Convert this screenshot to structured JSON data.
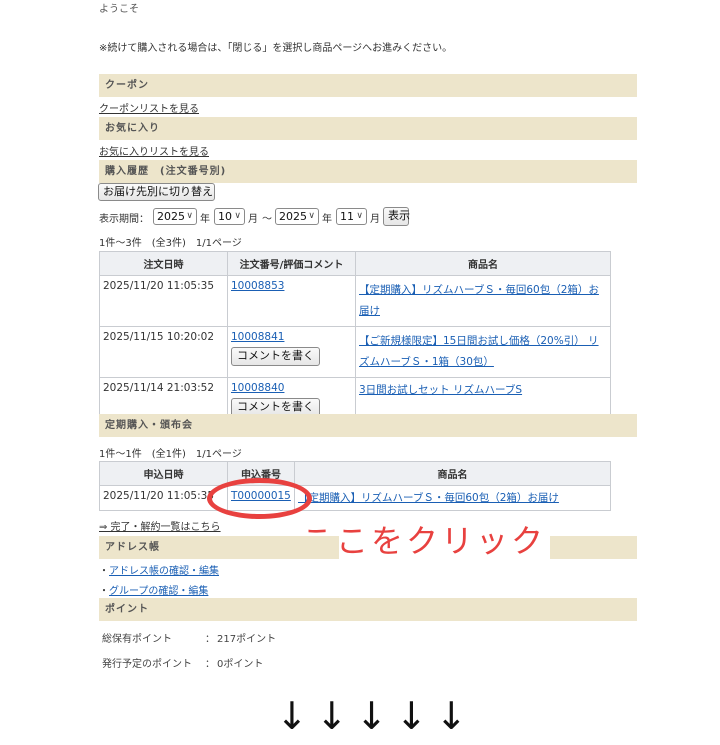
{
  "welcome": "ようこそ",
  "notice": "※続けて購入される場合は、「閉じる」を選択し商品ページへお進みください。",
  "coupon": {
    "title": "クーポン",
    "link": "クーポンリストを見る"
  },
  "favorites": {
    "title": "お気に入り",
    "link": "お気に入りリストを見る"
  },
  "history": {
    "title": "購入履歴　(注文番号別)",
    "switch_button": "お届け先別に切り替え",
    "period_label": "表示期間：",
    "from_year": "2025",
    "year_unit": "年",
    "from_month": "10",
    "month_unit": "月",
    "tilde": "〜",
    "to_year": "2025",
    "to_month": "11",
    "show_button": "表示",
    "count": "1件〜3件　(全3件)　1/1ページ",
    "columns": [
      "注文日時",
      "注文番号/評価コメント",
      "商品名"
    ],
    "comment_button": "コメントを書く",
    "rows": [
      {
        "date": "2025/11/20 11:05:35",
        "order": "10008853",
        "product": "【定期購入】リズムハーブＳ・毎回60包（2箱）お届け"
      },
      {
        "date": "2025/11/15 10:20:02",
        "order": "10008841",
        "product": "【ご新規様限定】15日間お試し価格（20%引） リズムハーブＳ・1箱（30包）"
      },
      {
        "date": "2025/11/14 21:03:52",
        "order": "10008840",
        "product": "3日間お試しセット リズムハーブS"
      }
    ]
  },
  "subscription": {
    "title": "定期購入・頒布会",
    "count": "1件〜1件　(全1件)　1/1ページ",
    "columns": [
      "申込日時",
      "申込番号",
      "商品名"
    ],
    "rows": [
      {
        "date": "2025/11/20 11:05:35",
        "number": "T00000015",
        "product": "【定期購入】リズムハーブＳ・毎回60包（2箱）お届け"
      }
    ],
    "completed_link": "⇒ 完了・解約一覧はこちら"
  },
  "annotation": {
    "click_here": "ここをクリック",
    "arrows": "↓↓↓↓↓",
    "ring_color": "#e8413f"
  },
  "address": {
    "title": "アドレス帳",
    "links": [
      "アドレス帳の確認・編集",
      "グループの確認・編集"
    ]
  },
  "points": {
    "title": "ポイント",
    "total_label": "総保有ポイント",
    "total_value": "217ポイント",
    "pending_label": "発行予定のポイント",
    "pending_value": "0ポイント",
    "separator": "："
  },
  "colors": {
    "section_bg": "#ede5cb",
    "link": "#1a5fb4",
    "accent": "#e8413f"
  }
}
